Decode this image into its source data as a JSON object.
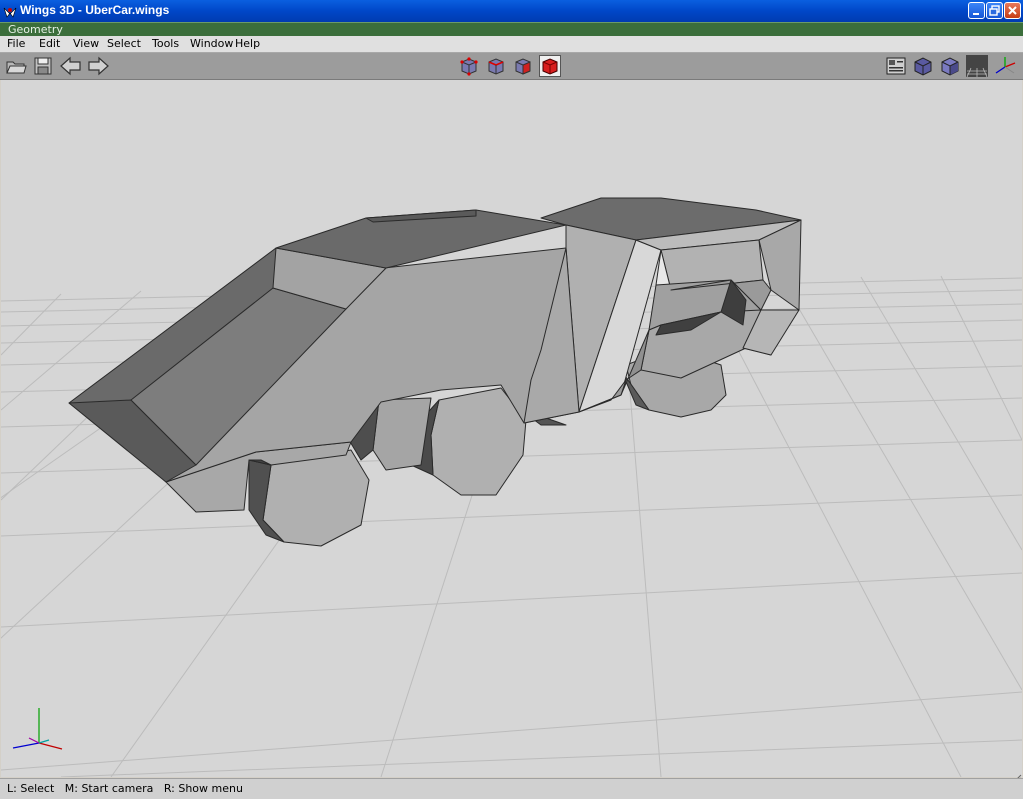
{
  "window": {
    "title": "Wings 3D - UberCar.wings"
  },
  "object_bar": {
    "label": "Geometry"
  },
  "menu": {
    "items": [
      "File",
      "Edit",
      "View",
      "Select",
      "Tools",
      "Window",
      "Help"
    ]
  },
  "toolbar": {
    "left": [
      "open-folder-icon",
      "save-icon",
      "undo-arrow-icon",
      "redo-arrow-icon"
    ],
    "selection_modes": [
      "vertex-mode",
      "edge-mode",
      "face-mode",
      "body-mode"
    ],
    "active_mode": "body-mode",
    "right": [
      "toggle-workmode-icon",
      "smooth-preview-icon",
      "flat-shading-icon",
      "ground-plane-icon",
      "axes-icon"
    ]
  },
  "status": {
    "text": "L: Select   M: Start camera   R: Show menu"
  },
  "colors": {
    "titlebar": "#0047c8",
    "object_bar": "#3b6e3b",
    "viewport": "#d6d6d6",
    "active_mode": "#d81e1e"
  }
}
